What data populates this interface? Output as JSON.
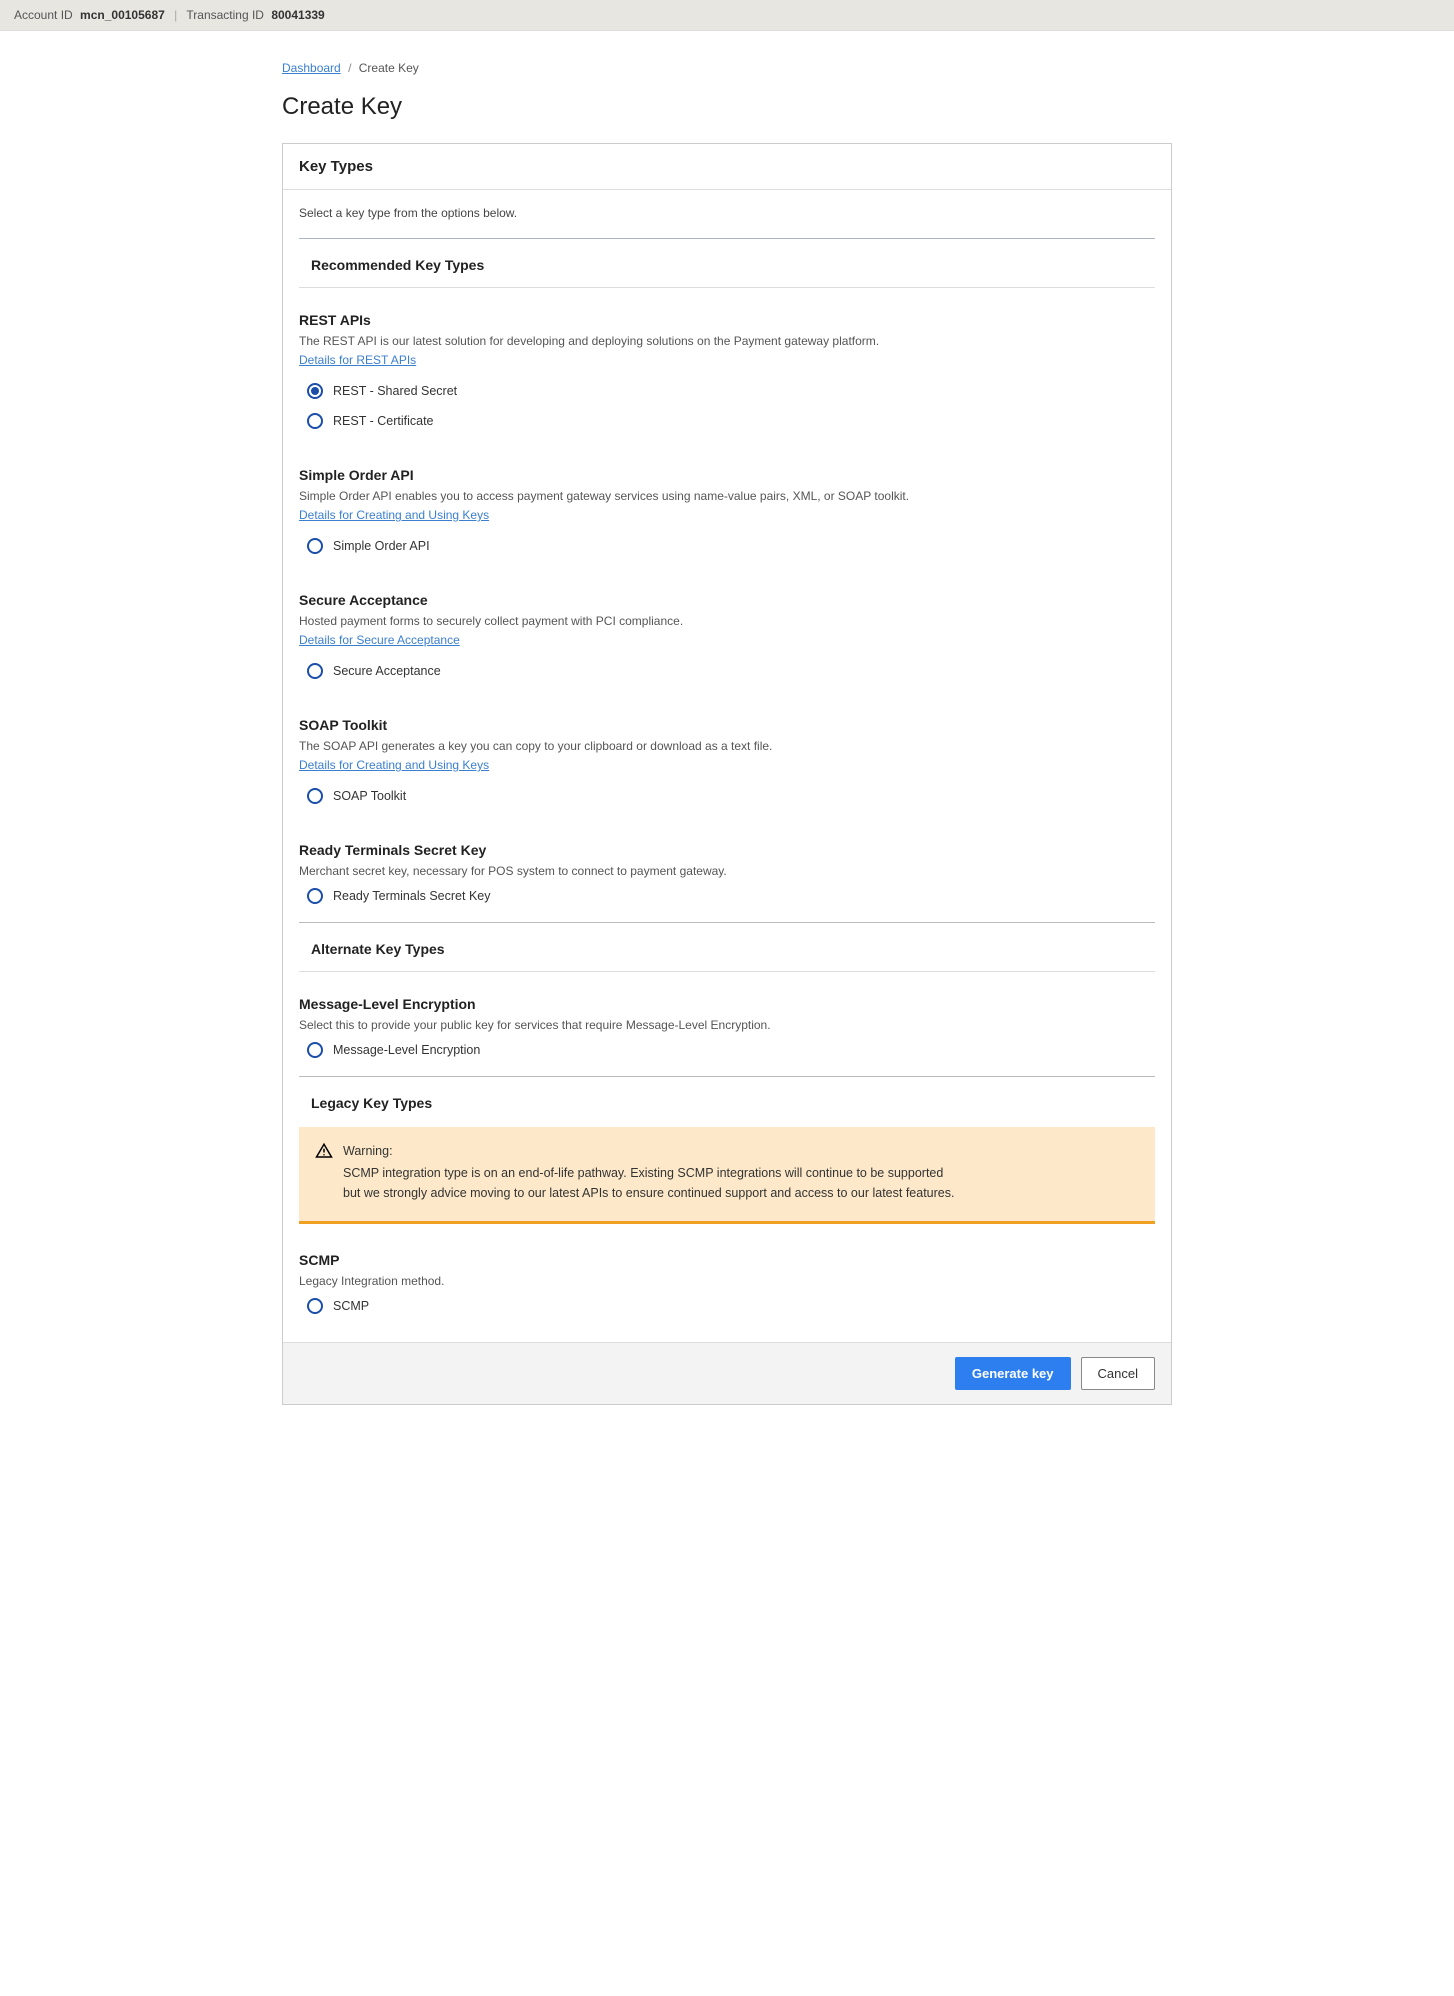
{
  "topbar": {
    "account_id_label": "Account ID",
    "account_id_value": "mcn_00105687",
    "transacting_id_label": "Transacting ID",
    "transacting_id_value": "80041339"
  },
  "breadcrumb": {
    "dashboard": "Dashboard",
    "current": "Create Key"
  },
  "page_title": "Create Key",
  "panel_header": "Key Types",
  "instruction": "Select a key type from the options below.",
  "sections": {
    "recommended_title": "Recommended Key Types",
    "alternate_title": "Alternate Key Types",
    "legacy_title": "Legacy Key Types"
  },
  "rest": {
    "heading": "REST APIs",
    "desc": "The REST API is our latest solution for developing and deploying solutions on the Payment gateway platform.",
    "link": "Details for REST APIs",
    "opt1": "REST - Shared Secret",
    "opt2": "REST - Certificate"
  },
  "simple_order": {
    "heading": "Simple Order API",
    "desc": "Simple Order API enables you to access payment gateway services using name-value pairs, XML, or SOAP toolkit.",
    "link": "Details for Creating and Using Keys",
    "opt": "Simple Order API"
  },
  "secure_acceptance": {
    "heading": "Secure Acceptance",
    "desc": "Hosted payment forms to securely collect payment with PCI compliance.",
    "link": "Details for Secure Acceptance",
    "opt": "Secure Acceptance"
  },
  "soap": {
    "heading": "SOAP Toolkit",
    "desc": "The SOAP API generates a key you can copy to your clipboard or download as a text file.",
    "link": "Details for Creating and Using Keys",
    "opt": "SOAP Toolkit"
  },
  "ready_terminals": {
    "heading": "Ready Terminals Secret Key",
    "desc": "Merchant secret key, necessary for POS system to connect to payment gateway.",
    "opt": "Ready Terminals Secret Key"
  },
  "mle": {
    "heading": "Message-Level Encryption",
    "desc": "Select this to provide your public key for services that require Message-Level Encryption.",
    "opt": "Message-Level Encryption"
  },
  "warning": {
    "title": "Warning:",
    "body": "SCMP integration type is on an end-of-life pathway. Existing SCMP integrations will continue to be supported but we strongly advice moving to our latest APIs to ensure continued support and access to our latest features."
  },
  "scmp": {
    "heading": "SCMP",
    "desc": "Legacy Integration method.",
    "opt": "SCMP"
  },
  "buttons": {
    "generate": "Generate key",
    "cancel": "Cancel"
  }
}
